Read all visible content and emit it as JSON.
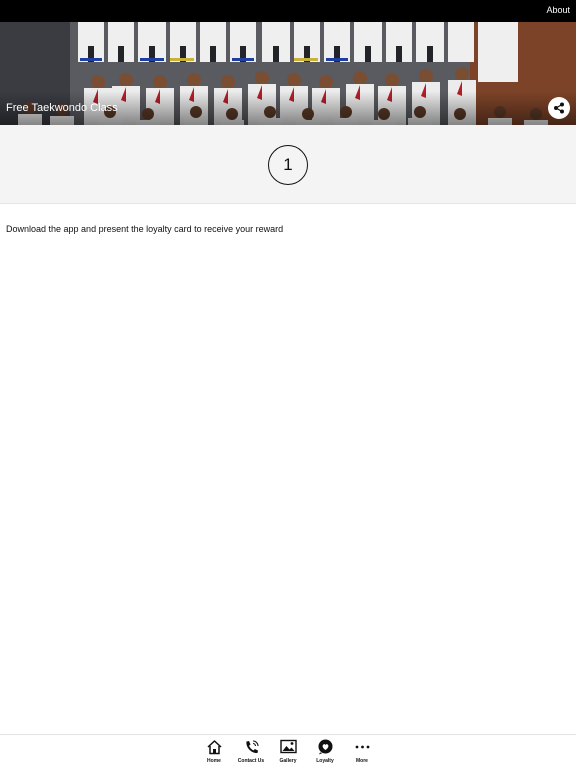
{
  "header": {
    "about_label": "About"
  },
  "hero": {
    "title": "Free Taekwondo Class",
    "image_icon": "group-photo"
  },
  "loyalty": {
    "stamp_count": "1",
    "reward_text": "Download the app and present the loyalty card to receive your reward"
  },
  "tabs": [
    {
      "label": "Home",
      "icon": "home-icon"
    },
    {
      "label": "Contact Us",
      "icon": "phone-icon"
    },
    {
      "label": "Gallery",
      "icon": "gallery-icon"
    },
    {
      "label": "Loyalty",
      "icon": "heart-bubble-icon"
    },
    {
      "label": "More",
      "icon": "more-dots-icon"
    }
  ],
  "colors": {
    "topbar": "#000000",
    "stamp_bg": "#f4f4f4",
    "text": "#111111"
  }
}
